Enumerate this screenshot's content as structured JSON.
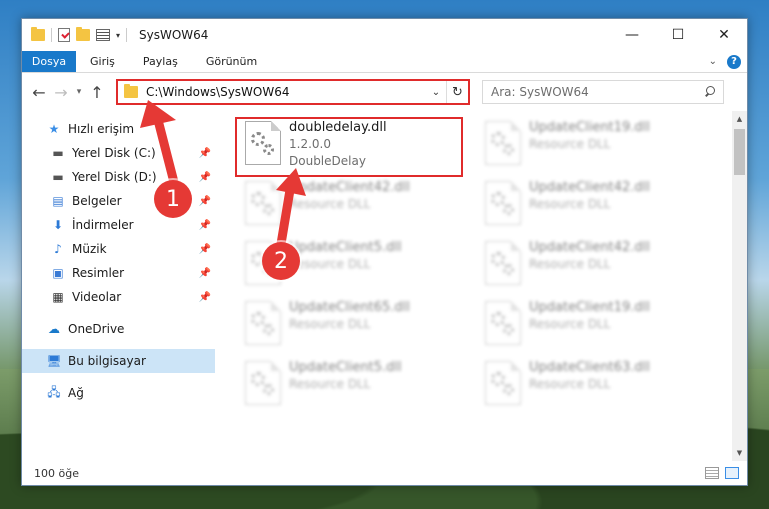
{
  "window": {
    "title": "SysWOW64",
    "controls": {
      "minimize": "—",
      "maximize": "☐",
      "close": "✕"
    }
  },
  "ribbon": {
    "tabs": [
      "Dosya",
      "Giriş",
      "Paylaş",
      "Görünüm"
    ]
  },
  "nav": {
    "address": "C:\\Windows\\SysWOW64",
    "search_placeholder": "Ara: SysWOW64"
  },
  "sidebar": {
    "quick_access": "Hızlı erişim",
    "items": [
      {
        "label": "Yerel Disk (C:)",
        "icon": "drive-icon"
      },
      {
        "label": "Yerel Disk (D:)",
        "icon": "drive-icon"
      },
      {
        "label": "Belgeler",
        "icon": "documents-icon"
      },
      {
        "label": "İndirmeler",
        "icon": "download-icon"
      },
      {
        "label": "Müzik",
        "icon": "music-icon"
      },
      {
        "label": "Resimler",
        "icon": "pictures-icon"
      },
      {
        "label": "Videolar",
        "icon": "videos-icon"
      }
    ],
    "onedrive": "OneDrive",
    "this_pc": "Bu bilgisayar",
    "network": "Ağ"
  },
  "files": [
    {
      "name": "doubledelay.dll",
      "line2": "1.2.0.0",
      "line3": "DoubleDelay",
      "highlighted": true
    },
    {
      "name": "UpdateClient19.dll",
      "line2": "Resource DLL"
    },
    {
      "name": "UpdateClient42.dll",
      "line2": "Resource DLL"
    },
    {
      "name": "UpdateClient42.dll",
      "line2": "Resource DLL"
    },
    {
      "name": "UpdateClient5.dll",
      "line2": "Resource DLL"
    },
    {
      "name": "UpdateClient42.dll",
      "line2": "Resource DLL"
    },
    {
      "name": "UpdateClient65.dll",
      "line2": "Resource DLL"
    },
    {
      "name": "UpdateClient19.dll",
      "line2": "Resource DLL"
    },
    {
      "name": "UpdateClient5.dll",
      "line2": "Resource DLL"
    },
    {
      "name": "UpdateClient63.dll",
      "line2": "Resource DLL"
    }
  ],
  "status": {
    "count": "100 öğe"
  },
  "annotations": {
    "badge1": "1",
    "badge2": "2",
    "color": "#e53935"
  }
}
